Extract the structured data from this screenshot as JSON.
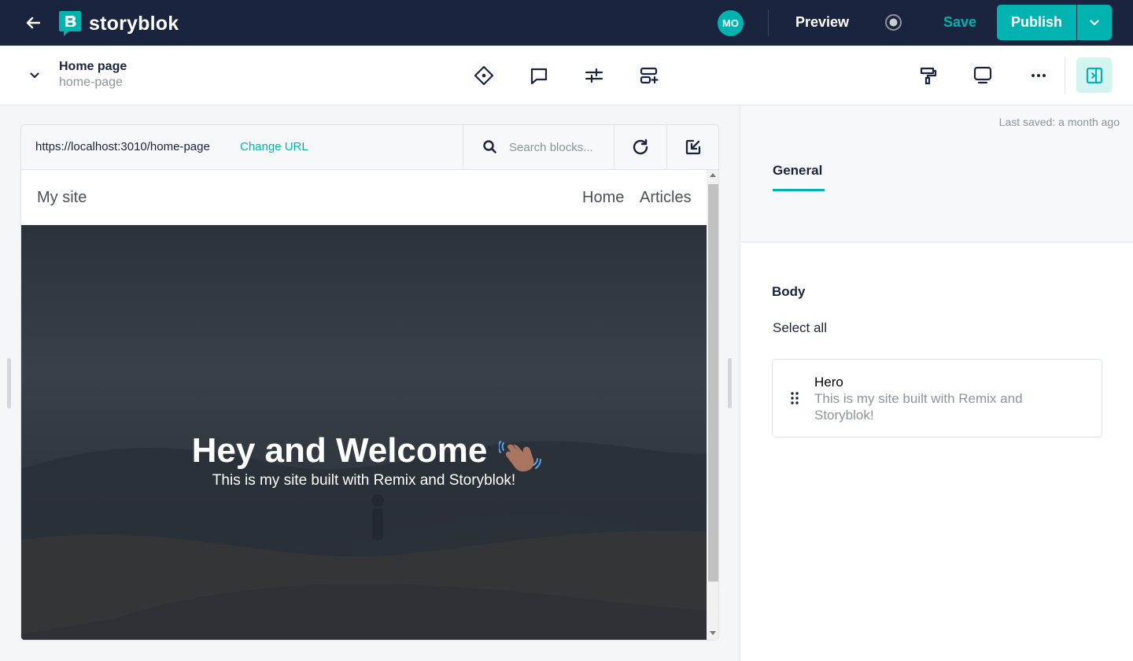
{
  "header": {
    "logo_text": "storyblok",
    "avatar_initials": "MO",
    "preview_label": "Preview",
    "save_label": "Save",
    "publish_label": "Publish"
  },
  "story": {
    "name": "Home page",
    "slug": "home-page"
  },
  "toolbar": {
    "icons": [
      "history-icon",
      "comments-icon",
      "settings-sliders-icon",
      "add-block-icon",
      "format-paint-icon",
      "device-preview-icon",
      "more-icon",
      "toggle-sidebar-icon"
    ]
  },
  "preview": {
    "url": "https://localhost:3010/home-page",
    "change_url_label": "Change URL",
    "search_placeholder": "Search blocks...",
    "site": {
      "name": "My site",
      "nav": [
        "Home",
        "Articles"
      ],
      "hero_title": "Hey and Welcome",
      "hero_subtitle": "This is my site built with Remix and Storyblok!"
    }
  },
  "panel": {
    "last_saved": "Last saved: a month ago",
    "tab_label": "General",
    "field_label": "Body",
    "select_all_label": "Select all",
    "blocks": [
      {
        "name": "Hero",
        "description": "This is my site built with Remix and Storyblok!"
      }
    ]
  },
  "colors": {
    "brand_navy": "#1b243f",
    "accent_teal": "#00b3b0",
    "active_toggle_bg": "#d4f4f2"
  }
}
